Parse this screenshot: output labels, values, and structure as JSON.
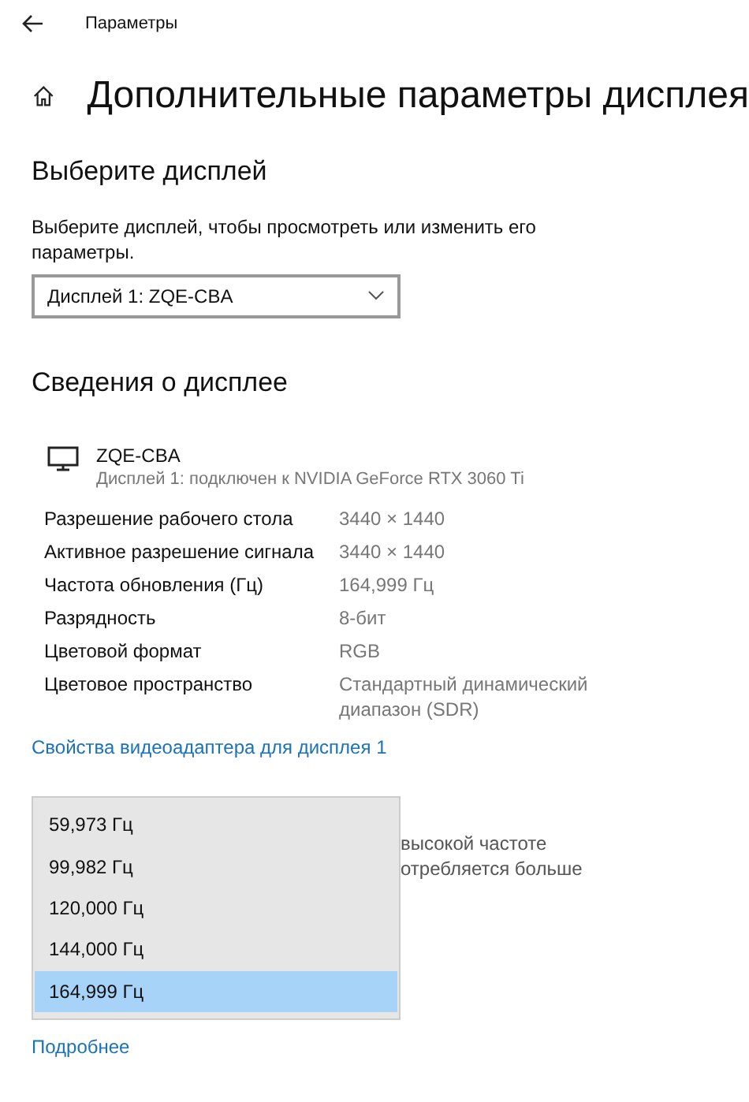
{
  "window": {
    "title": "Параметры"
  },
  "page_title": "Дополнительные параметры дисплея",
  "select_section": {
    "heading": "Выберите дисплей",
    "description": "Выберите дисплей, чтобы просмотреть или изменить его параметры.",
    "value": "Дисплей 1: ZQE-CBA"
  },
  "info_section": {
    "heading": "Сведения о дисплее",
    "monitor_name": "ZQE-CBA",
    "monitor_subtitle": "Дисплей 1: подключен к NVIDIA GeForce RTX 3060 Ti",
    "rows": [
      {
        "label": "Разрешение рабочего стола",
        "value": "3440 × 1440"
      },
      {
        "label": "Активное разрешение сигнала",
        "value": "3440 × 1440"
      },
      {
        "label": "Частота обновления (Гц)",
        "value": "164,999 Гц"
      },
      {
        "label": "Разрядность",
        "value": "8-бит"
      },
      {
        "label": "Цветовой формат",
        "value": "RGB"
      },
      {
        "label": "Цветовое пространство",
        "value": "Стандартный динамический диапазон (SDR)"
      }
    ],
    "link": "Свойства видеоадаптера для дисплея 1"
  },
  "refresh_section": {
    "hidden_text": [
      "высокой частоте",
      "отребляется больше"
    ],
    "dropdown_options": [
      {
        "label": "59,973 Гц",
        "selected": false
      },
      {
        "label": "99,982 Гц",
        "selected": false
      },
      {
        "label": "120,000 Гц",
        "selected": false
      },
      {
        "label": "144,000 Гц",
        "selected": false
      },
      {
        "label": "164,999 Гц",
        "selected": true
      }
    ],
    "link": "Подробнее"
  }
}
